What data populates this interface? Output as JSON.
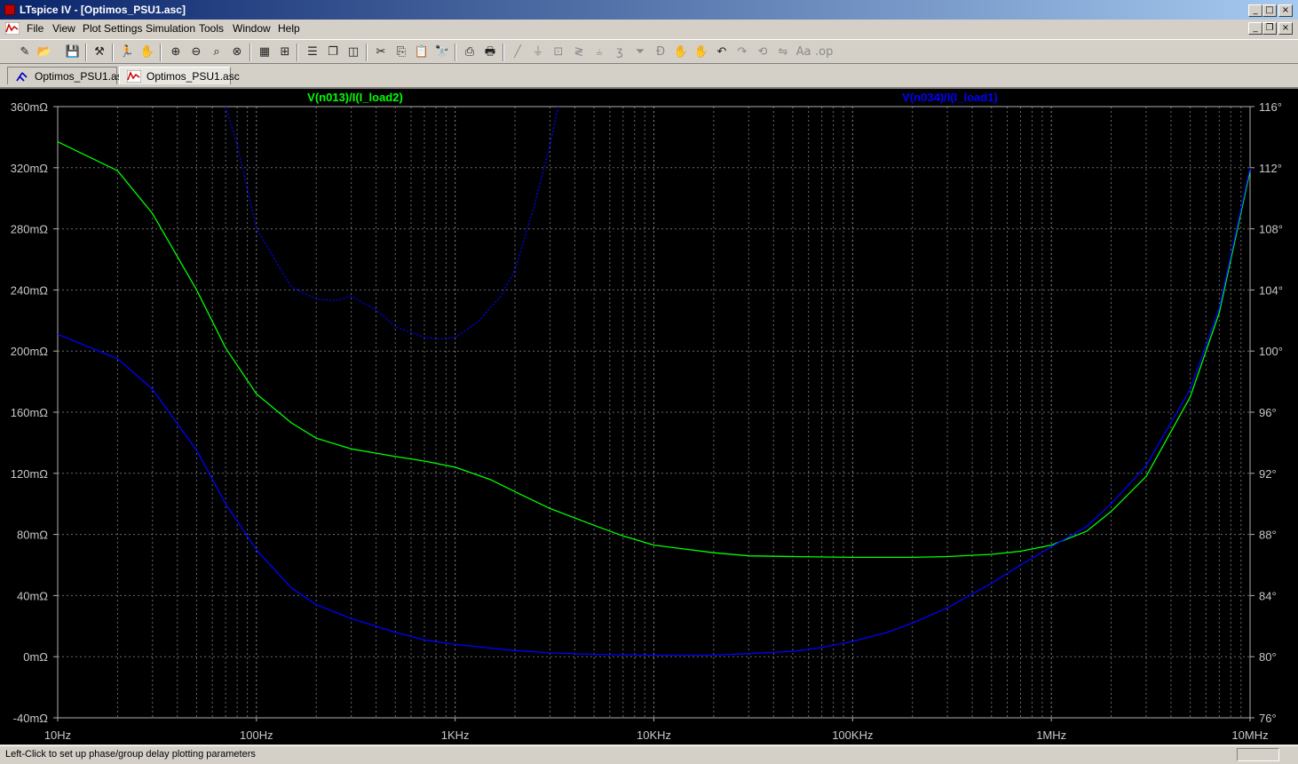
{
  "window": {
    "title": "LTspice IV - [Optimos_PSU1.asc]",
    "controls": [
      "minimize",
      "maximize",
      "close"
    ]
  },
  "menu": [
    {
      "label": "File"
    },
    {
      "label": "View"
    },
    {
      "label": "Plot Settings"
    },
    {
      "label": "Simulation"
    },
    {
      "label": "Tools"
    },
    {
      "label": "Window"
    },
    {
      "label": "Help"
    }
  ],
  "toolbar": {
    "icons": [
      "new-schematic-icon",
      "open-icon",
      "save-icon",
      "hammer-icon",
      "run-icon",
      "pan-hand-icon",
      "zoom-in-icon",
      "zoom-out-icon",
      "zoom-fit-icon",
      "zoom-cancel-icon",
      "autorange-icon",
      "grid-icon",
      "tile-horizontal-icon",
      "cascade-icon",
      "tile-vertical-icon",
      "cut-icon",
      "copy-icon",
      "paste-icon",
      "find-icon",
      "print-setup-icon",
      "print-icon",
      "wire-icon",
      "ground-icon",
      "label-icon",
      "resistor-icon",
      "capacitor-icon",
      "inductor-icon",
      "diode-icon",
      "component-icon",
      "move-icon",
      "drag-icon",
      "undo-icon",
      "redo-icon",
      "rotate-icon",
      "mirror-icon",
      "text-icon",
      "spice-directive-icon"
    ]
  },
  "tabs": [
    {
      "label": "Optimos_PSU1.asc",
      "icon": "schematic-icon",
      "active": false
    },
    {
      "label": "Optimos_PSU1.asc",
      "icon": "waveform-icon",
      "active": true
    }
  ],
  "status": {
    "text": "Left-Click to set up phase/group delay plotting parameters"
  },
  "chart_data": {
    "type": "line",
    "background": "#000000",
    "grid": true,
    "x_scale": "log",
    "xlim_hz": [
      10,
      10000000
    ],
    "x_ticks": [
      {
        "value": 10,
        "label": "10Hz"
      },
      {
        "value": 100,
        "label": "100Hz"
      },
      {
        "value": 1000,
        "label": "1KHz"
      },
      {
        "value": 10000,
        "label": "10KHz"
      },
      {
        "value": 100000,
        "label": "100KHz"
      },
      {
        "value": 1000000,
        "label": "1MHz"
      },
      {
        "value": 10000000,
        "label": "10MHz"
      }
    ],
    "y_left": {
      "unit": "mΩ",
      "lim": [
        -40,
        360
      ],
      "ticks": [
        {
          "value": 360,
          "label": "360mΩ"
        },
        {
          "value": 320,
          "label": "320mΩ"
        },
        {
          "value": 280,
          "label": "280mΩ"
        },
        {
          "value": 240,
          "label": "240mΩ"
        },
        {
          "value": 200,
          "label": "200mΩ"
        },
        {
          "value": 160,
          "label": "160mΩ"
        },
        {
          "value": 120,
          "label": "120mΩ"
        },
        {
          "value": 80,
          "label": "80mΩ"
        },
        {
          "value": 40,
          "label": "40mΩ"
        },
        {
          "value": 0,
          "label": "0mΩ"
        },
        {
          "value": -40,
          "label": "-40mΩ"
        }
      ]
    },
    "y_right": {
      "unit": "°",
      "lim": [
        76,
        116
      ],
      "ticks": [
        {
          "value": 116,
          "label": "116°"
        },
        {
          "value": 112,
          "label": "112°"
        },
        {
          "value": 108,
          "label": "108°"
        },
        {
          "value": 104,
          "label": "104°"
        },
        {
          "value": 100,
          "label": "100°"
        },
        {
          "value": 96,
          "label": "96°"
        },
        {
          "value": 92,
          "label": "92°"
        },
        {
          "value": 88,
          "label": "88°"
        },
        {
          "value": 84,
          "label": "84°"
        },
        {
          "value": 80,
          "label": "80°"
        },
        {
          "value": 76,
          "label": "76°"
        }
      ]
    },
    "series": [
      {
        "name": "V(n013)/I(I_load2)",
        "color": "#00ff00",
        "axis": "left",
        "style": "solid",
        "points": [
          [
            10,
            337
          ],
          [
            20,
            318
          ],
          [
            30,
            290
          ],
          [
            50,
            240
          ],
          [
            70,
            202
          ],
          [
            100,
            172
          ],
          [
            150,
            153
          ],
          [
            200,
            143
          ],
          [
            300,
            136
          ],
          [
            500,
            131
          ],
          [
            700,
            128
          ],
          [
            1000,
            124
          ],
          [
            1500,
            116
          ],
          [
            2000,
            108
          ],
          [
            3000,
            97
          ],
          [
            5000,
            86
          ],
          [
            7000,
            79
          ],
          [
            10000,
            73
          ],
          [
            20000,
            68
          ],
          [
            30000,
            66
          ],
          [
            50000,
            65.5
          ],
          [
            100000,
            65
          ],
          [
            200000,
            65
          ],
          [
            300000,
            65.5
          ],
          [
            500000,
            67
          ],
          [
            700000,
            69
          ],
          [
            1000000,
            73
          ],
          [
            1500000,
            82
          ],
          [
            2000000,
            95
          ],
          [
            3000000,
            118
          ],
          [
            5000000,
            170
          ],
          [
            7000000,
            225
          ],
          [
            10000000,
            318
          ]
        ]
      },
      {
        "name": "V(n034)/I(I_load1)",
        "color": "#0000ff",
        "axis": "left",
        "style": "solid",
        "points": [
          [
            10,
            211
          ],
          [
            20,
            195
          ],
          [
            30,
            175
          ],
          [
            50,
            135
          ],
          [
            70,
            100
          ],
          [
            100,
            70
          ],
          [
            150,
            45
          ],
          [
            200,
            34
          ],
          [
            300,
            25
          ],
          [
            500,
            16
          ],
          [
            700,
            11
          ],
          [
            1000,
            8
          ],
          [
            2000,
            4
          ],
          [
            3000,
            2.5
          ],
          [
            5000,
            1.5
          ],
          [
            10000,
            1
          ],
          [
            20000,
            1
          ],
          [
            30000,
            2
          ],
          [
            50000,
            3.5
          ],
          [
            70000,
            6
          ],
          [
            100000,
            10
          ],
          [
            150000,
            16
          ],
          [
            200000,
            22
          ],
          [
            300000,
            32
          ],
          [
            500000,
            48
          ],
          [
            700000,
            60
          ],
          [
            1000000,
            72
          ],
          [
            1500000,
            85
          ],
          [
            2000000,
            100
          ],
          [
            3000000,
            125
          ],
          [
            5000000,
            175
          ],
          [
            7000000,
            228
          ],
          [
            10000000,
            320
          ]
        ]
      },
      {
        "name": "phase V(n034)/I(I_load1)",
        "color": "#0000ff",
        "axis": "right",
        "style": "dashed",
        "points": [
          [
            70,
            116
          ],
          [
            80,
            113.5
          ],
          [
            100,
            108
          ],
          [
            150,
            104.2
          ],
          [
            200,
            103.4
          ],
          [
            250,
            103.3
          ],
          [
            300,
            103.6
          ],
          [
            400,
            102.7
          ],
          [
            500,
            101.6
          ],
          [
            700,
            100.9
          ],
          [
            850,
            100.8
          ],
          [
            1000,
            100.9
          ],
          [
            1300,
            101.9
          ],
          [
            1700,
            103.6
          ],
          [
            2000,
            105.3
          ],
          [
            2500,
            109.5
          ],
          [
            3000,
            113.5
          ],
          [
            3300,
            116
          ]
        ]
      }
    ]
  }
}
